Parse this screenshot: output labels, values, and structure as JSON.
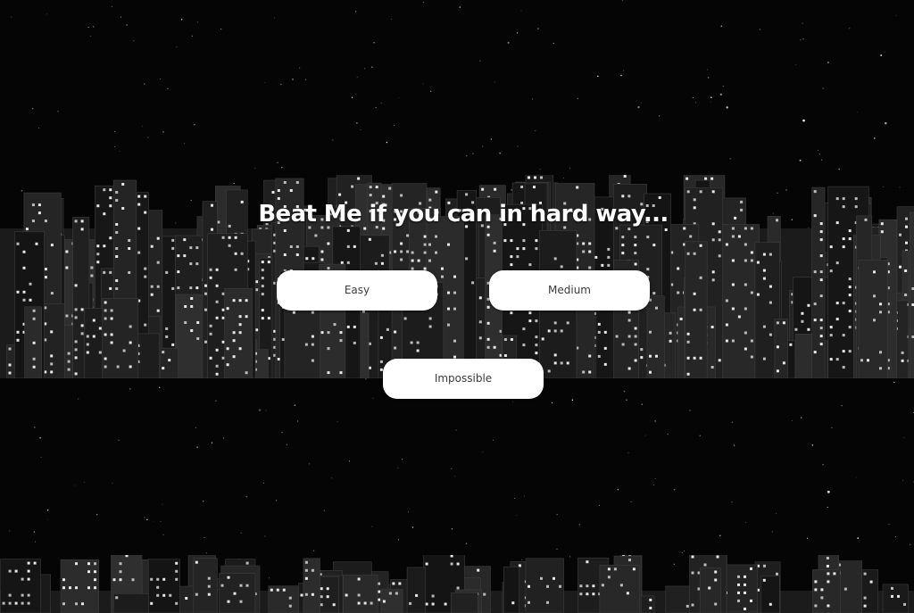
{
  "heading": "Beat Me if you can in hard way...",
  "buttons": {
    "easy": "Easy",
    "medium": "Medium",
    "impossible": "Impossible"
  },
  "colors": {
    "background": "#050505",
    "button_bg": "#ffffff",
    "button_text": "#3a3a3a",
    "heading_text": "#ffffff"
  }
}
